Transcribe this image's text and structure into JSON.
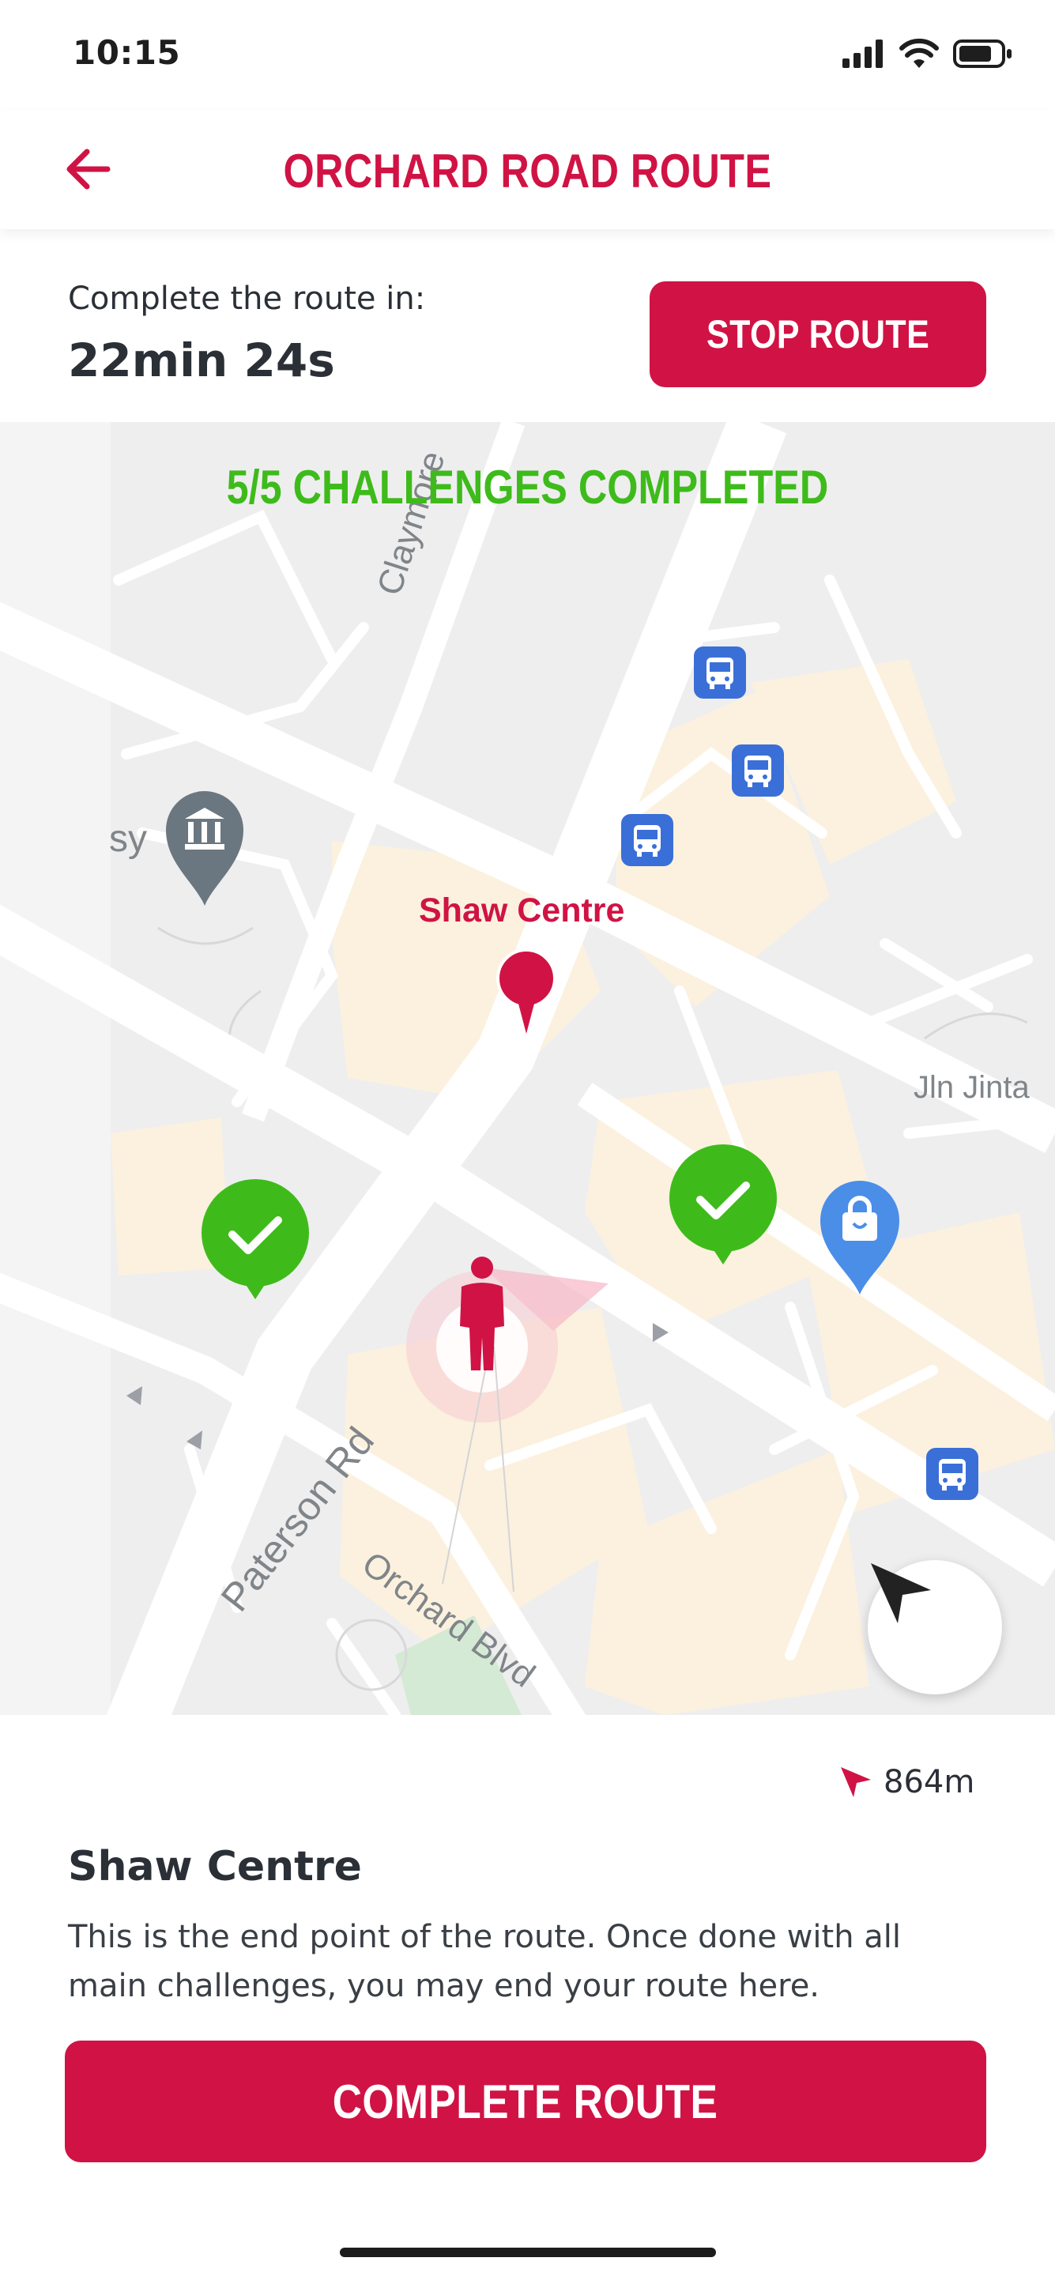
{
  "status_bar": {
    "time": "10:15"
  },
  "header": {
    "back_icon": "arrow-left-icon",
    "title": "ORCHARD ROAD ROUTE"
  },
  "timer": {
    "label": "Complete the route in:",
    "value": "22min 24s",
    "stop_label": "STOP ROUTE"
  },
  "map": {
    "banner": "5/5 CHALLENGES COMPLETED",
    "streets": [
      "Claymore",
      "Jln Jinta",
      "Paterson Rd",
      "Orchard Blvd"
    ],
    "partial_label": "sy",
    "place_label": "Shaw Centre",
    "icons": [
      "bus-stop-icon",
      "museum-pin-icon",
      "shopping-bag-pin-icon",
      "check-pin-icon",
      "user-location-icon",
      "navigation-arrow-icon"
    ]
  },
  "sheet": {
    "distance": "864m",
    "title": "Shaw Centre",
    "description": "This is the end point of the route. Once done with all main challenges, you may end your route here.",
    "complete_label": "COMPLETE ROUTE"
  },
  "colors": {
    "brand": "#d01344",
    "success": "#3ebb1b",
    "bus": "#3a6fd8",
    "road": "#ffffff",
    "block": "#fbf1de"
  }
}
